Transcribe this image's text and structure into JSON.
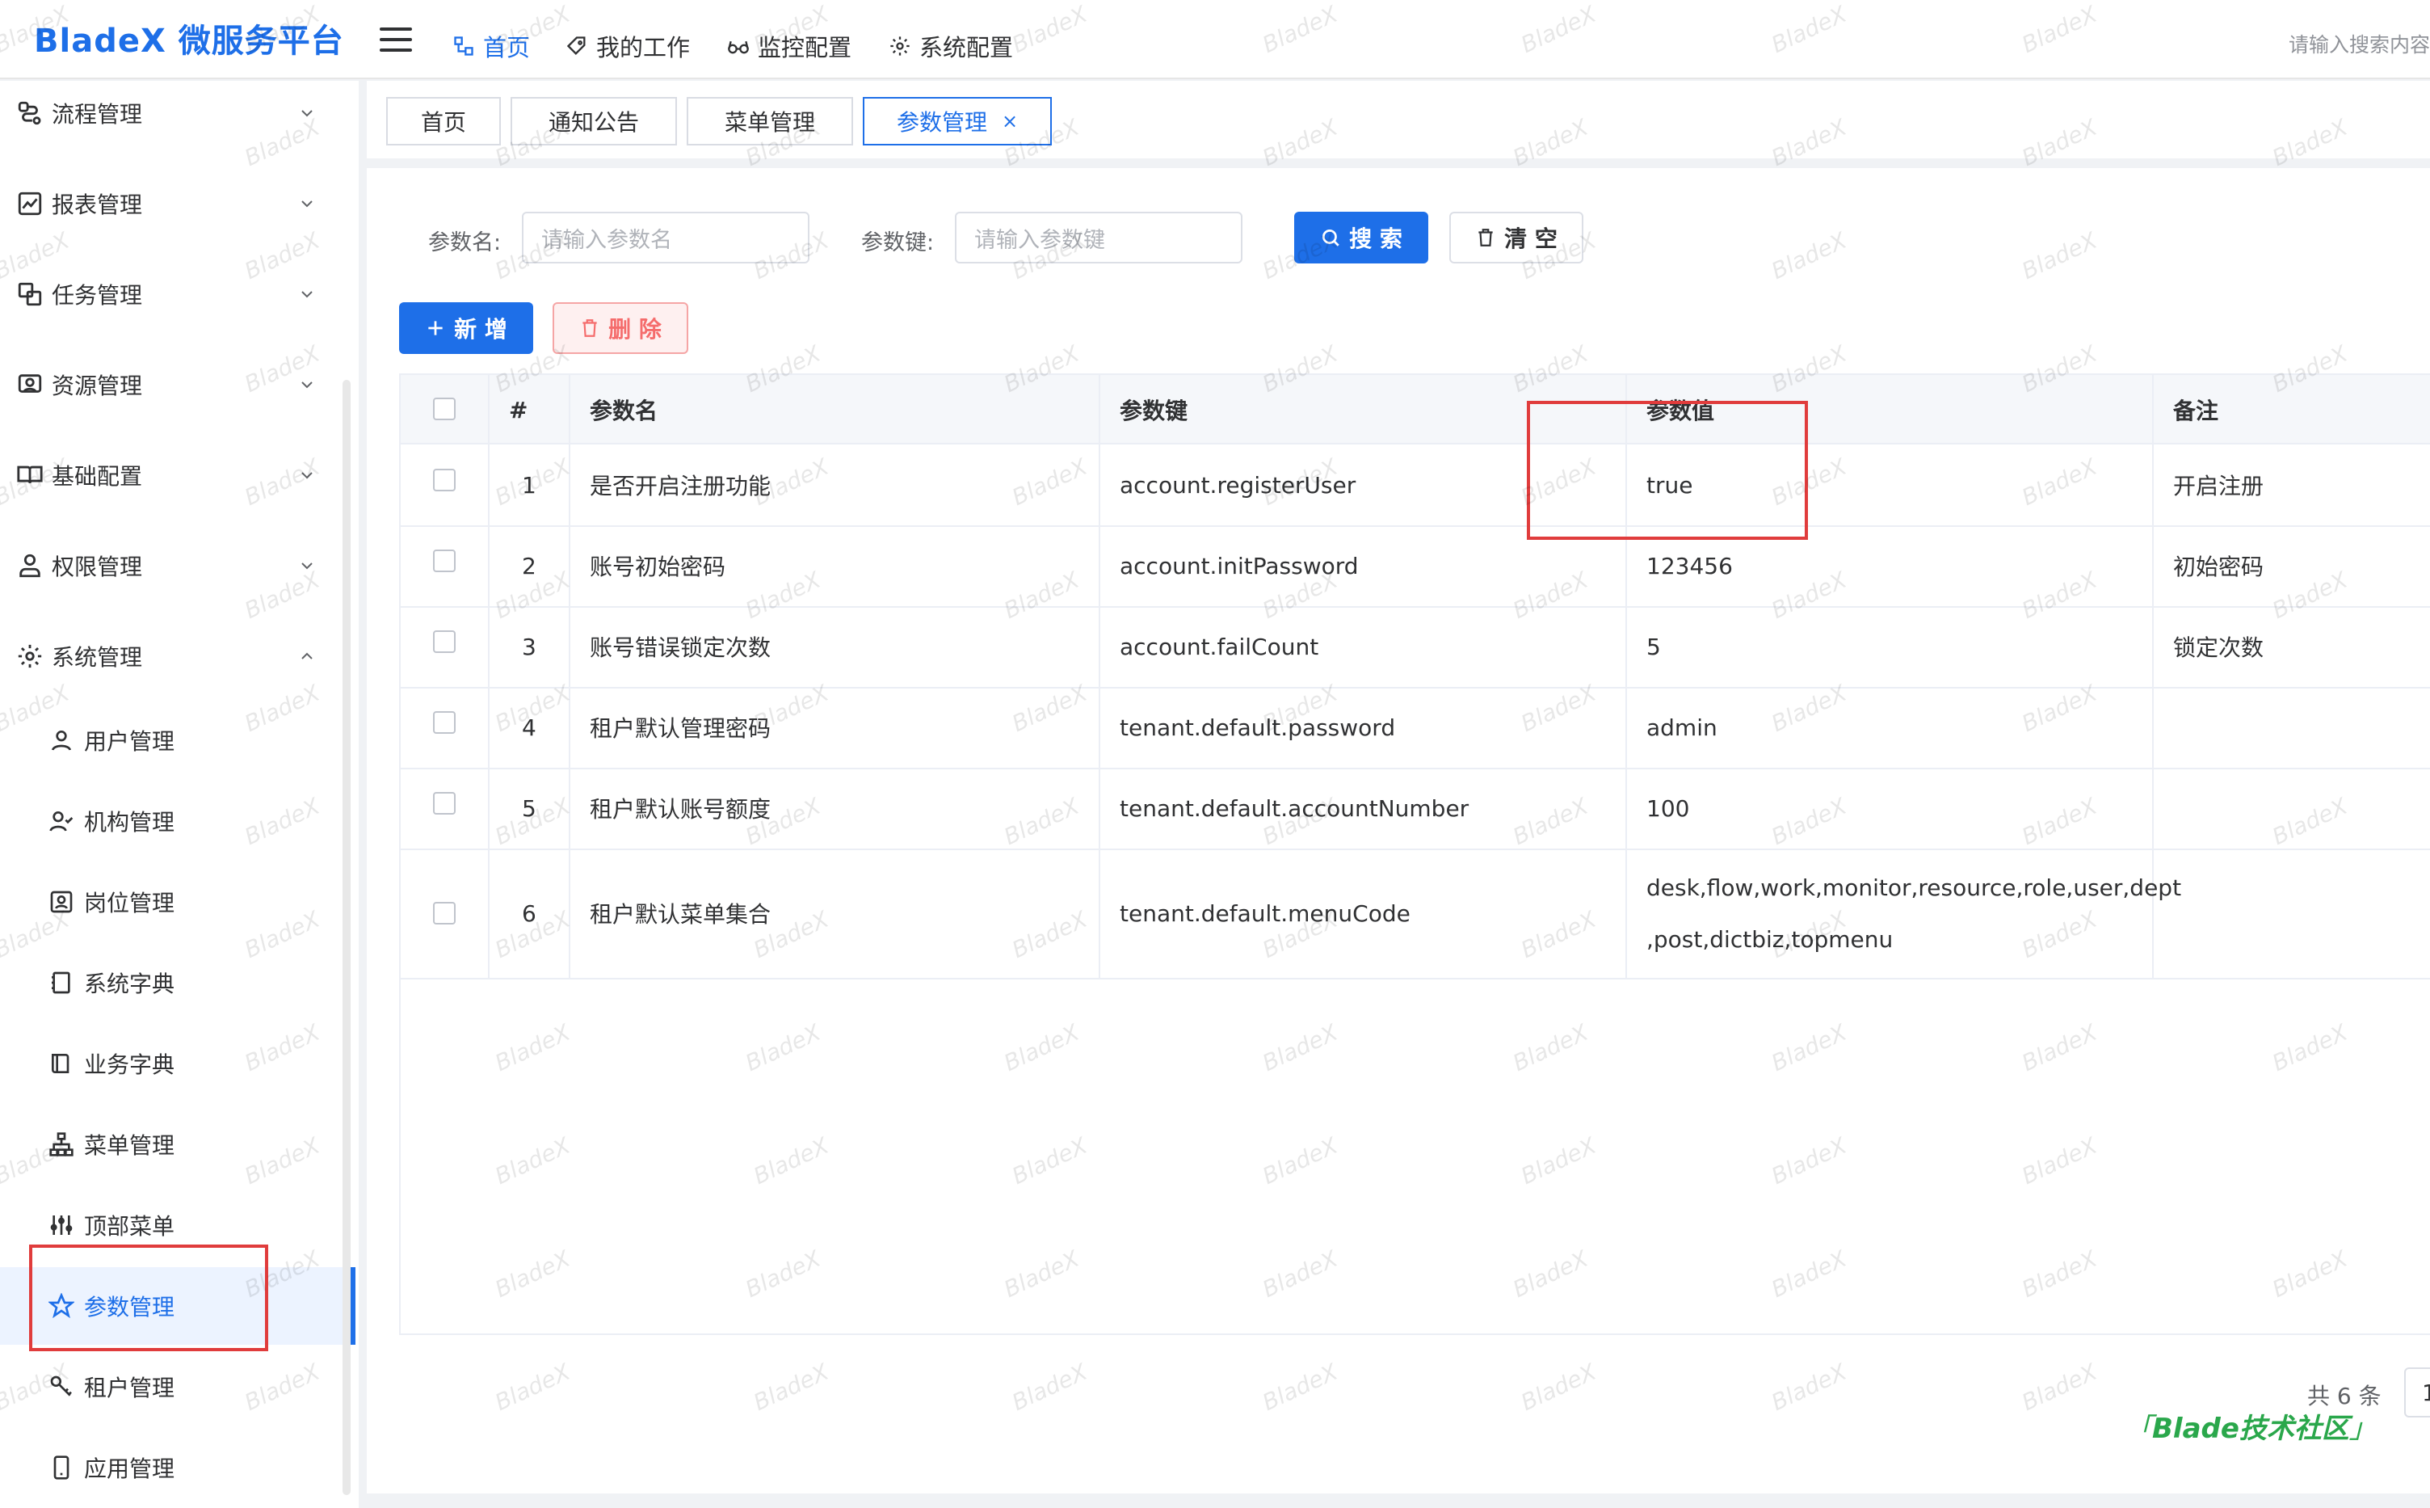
{
  "header": {
    "logo": "BladeX 微服务平台",
    "nav": [
      {
        "label": "首页",
        "icon": "home-icon"
      },
      {
        "label": "我的工作",
        "icon": "tag-icon"
      },
      {
        "label": "监控配置",
        "icon": "glasses-icon"
      },
      {
        "label": "系统配置",
        "icon": "gear-icon"
      }
    ],
    "search_placeholder": "请输入搜索内容"
  },
  "sidebar": {
    "groups": [
      {
        "label": "流程管理",
        "icon": "workflow-icon"
      },
      {
        "label": "报表管理",
        "icon": "chart-icon"
      },
      {
        "label": "任务管理",
        "icon": "task-icon"
      },
      {
        "label": "资源管理",
        "icon": "resource-icon"
      },
      {
        "label": "基础配置",
        "icon": "book-icon"
      },
      {
        "label": "权限管理",
        "icon": "permission-icon"
      },
      {
        "label": "系统管理",
        "icon": "gear-icon"
      }
    ],
    "sub_items": [
      {
        "label": "用户管理",
        "icon": "user-icon"
      },
      {
        "label": "机构管理",
        "icon": "org-icon"
      },
      {
        "label": "岗位管理",
        "icon": "badge-icon"
      },
      {
        "label": "系统字典",
        "icon": "dict-icon"
      },
      {
        "label": "业务字典",
        "icon": "book-icon"
      },
      {
        "label": "菜单管理",
        "icon": "tree-icon"
      },
      {
        "label": "顶部菜单",
        "icon": "sliders-icon"
      },
      {
        "label": "参数管理",
        "icon": "star-icon"
      },
      {
        "label": "租户管理",
        "icon": "key-icon"
      },
      {
        "label": "应用管理",
        "icon": "phone-icon"
      }
    ],
    "active_item": "参数管理"
  },
  "tabs": [
    {
      "label": "首页"
    },
    {
      "label": "通知公告"
    },
    {
      "label": "菜单管理"
    },
    {
      "label": "参数管理",
      "close": "×"
    }
  ],
  "search": {
    "param_name_label": "参数名:",
    "param_name_placeholder": "请输入参数名",
    "param_key_label": "参数键:",
    "param_key_placeholder": "请输入参数键",
    "search_button": "搜 索",
    "clear_button": "清 空"
  },
  "actions": {
    "add_button": "新 增",
    "delete_button": "删 除"
  },
  "table": {
    "columns": [
      "#",
      "参数名",
      "参数键",
      "参数值",
      "备注"
    ],
    "rows": [
      {
        "index": "1",
        "name": "是否开启注册功能",
        "key": "account.registerUser",
        "value": "true",
        "remark": "开启注册"
      },
      {
        "index": "2",
        "name": "账号初始密码",
        "key": "account.initPassword",
        "value": "123456",
        "remark": "初始密码"
      },
      {
        "index": "3",
        "name": "账号错误锁定次数",
        "key": "account.failCount",
        "value": "5",
        "remark": "锁定次数"
      },
      {
        "index": "4",
        "name": "租户默认管理密码",
        "key": "tenant.default.password",
        "value": "admin",
        "remark": ""
      },
      {
        "index": "5",
        "name": "租户默认账号额度",
        "key": "tenant.default.accountNumber",
        "value": "100",
        "remark": ""
      },
      {
        "index": "6",
        "name": "租户默认菜单集合",
        "key": "tenant.default.menuCode",
        "value_line1": "desk,flow,work,monitor,resource,role,user,dept",
        "value_line2": ",post,dictbiz,topmenu",
        "remark": ""
      }
    ]
  },
  "pagination": {
    "total": "共 6 条",
    "page": "1"
  },
  "footer_brand": "Blade技术社区",
  "watermark": "BladeX",
  "colors": {
    "primary": "#1e6fe8",
    "danger": "#f56c6c",
    "highlight_box": "#e03c3c",
    "brand_green": "#2aa74b"
  }
}
